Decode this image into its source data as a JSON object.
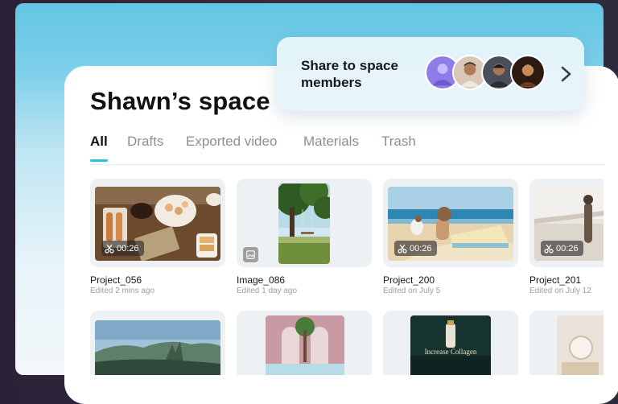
{
  "space": {
    "title": "Shawn’s space",
    "tabs": [
      {
        "label": "All",
        "active": true
      },
      {
        "label": "Drafts"
      },
      {
        "label": "Exported video"
      },
      {
        "label": "Materials"
      },
      {
        "label": "Trash"
      }
    ]
  },
  "share": {
    "text": "Share to space members",
    "avatars": [
      "member-1",
      "member-2",
      "member-3",
      "member-4"
    ],
    "chevron_icon": "chevron-right-icon"
  },
  "items": [
    {
      "name": "Project_056",
      "meta": "Edited 2 mins ago",
      "duration": "00:26",
      "kind": "video"
    },
    {
      "name": "Image_086",
      "meta": "Edited 1 day ago",
      "kind": "image"
    },
    {
      "name": "Project_200",
      "meta": "Edited on July 5",
      "duration": "00:26",
      "kind": "video"
    },
    {
      "name": "Project_201",
      "meta": "Edited on July 12",
      "duration": "00:26",
      "kind": "video"
    }
  ],
  "row2": {
    "thumb3_text": "Increase Collagen"
  },
  "colors": {
    "accent": "#23c7d9",
    "banner": "#62c6e4"
  }
}
